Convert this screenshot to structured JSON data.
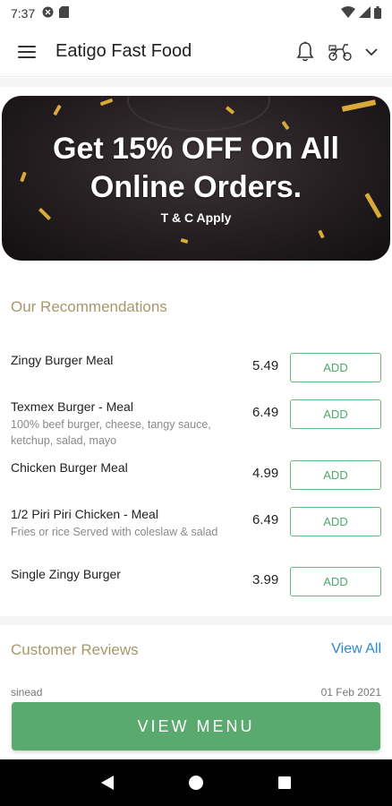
{
  "status_bar": {
    "time": "7:37",
    "icons": [
      "app-notification-icon",
      "sim-card-icon",
      "wifi-icon",
      "signal-icon",
      "battery-icon"
    ]
  },
  "app_bar": {
    "title": "Eatigo Fast Food",
    "icons": [
      "hamburger-menu-icon",
      "bell-icon",
      "delivery-scooter-icon",
      "chevron-down-icon"
    ]
  },
  "banner": {
    "headline": "Get 15% OFF On All Online Orders.",
    "subtext": "T & C Apply"
  },
  "recommendations": {
    "title": "Our Recommendations",
    "items": [
      {
        "name": "Zingy Burger Meal",
        "description": "",
        "price": "5.49",
        "button": "ADD"
      },
      {
        "name": "Texmex Burger - Meal",
        "description": "100% beef burger, cheese, tangy sauce, ketchup, salad, mayo",
        "price": "6.49",
        "button": "ADD"
      },
      {
        "name": "Chicken Burger Meal",
        "description": "",
        "price": "4.99",
        "button": "ADD"
      },
      {
        "name": "1/2 Piri Piri Chicken - Meal",
        "description": "Fries or rice  Served with coleslaw & salad",
        "price": "6.49",
        "button": "ADD"
      },
      {
        "name": "Single Zingy Burger",
        "description": "",
        "price": "3.99",
        "button": "ADD"
      }
    ]
  },
  "reviews": {
    "title": "Customer Reviews",
    "view_all": "View All",
    "peek_name": "sinead",
    "peek_date": "01 Feb 2021"
  },
  "cta": {
    "label": "VIEW MENU"
  },
  "colors": {
    "accent_gold": "#a8976a",
    "add_green": "#4da86a",
    "cta_green": "#5aaa70",
    "link_blue": "#2a8bc9"
  }
}
